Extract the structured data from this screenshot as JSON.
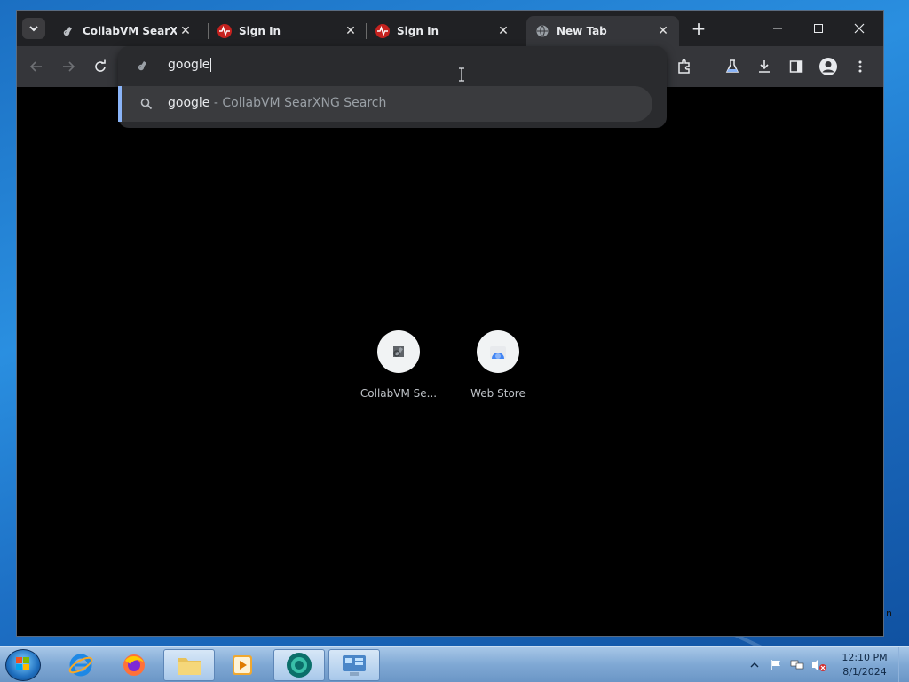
{
  "tabs": [
    {
      "title": "CollabVM SearXNG",
      "icon": "searxng-icon",
      "active": false
    },
    {
      "title": "Sign In",
      "icon": "pulse-icon",
      "active": false
    },
    {
      "title": "Sign In",
      "icon": "pulse-icon",
      "active": false
    },
    {
      "title": "New Tab",
      "icon": "globe-icon",
      "active": true
    }
  ],
  "tab_close_glyph": "✕",
  "new_tab_glyph": "+",
  "omnibox": {
    "value": "google",
    "suggestion": {
      "query": "google",
      "separator": " - ",
      "provider": "CollabVM SearXNG Search"
    }
  },
  "shortcuts": [
    {
      "label": "CollabVM Se...",
      "icon": "searxng-icon"
    },
    {
      "label": "Web Store",
      "icon": "webstore-icon"
    }
  ],
  "taskbar": {
    "clock_time": "12:10 PM",
    "clock_date": "8/1/2024",
    "apps": [
      "internet-explorer-icon",
      "firefox-icon",
      "file-explorer-icon",
      "media-player-icon",
      "chromium-icon",
      "control-panel-icon"
    ]
  },
  "colors": {
    "accent": "#8ab4f8",
    "tab_active": "#35363a",
    "background": "#000000",
    "pulse_red": "#c5221f"
  }
}
